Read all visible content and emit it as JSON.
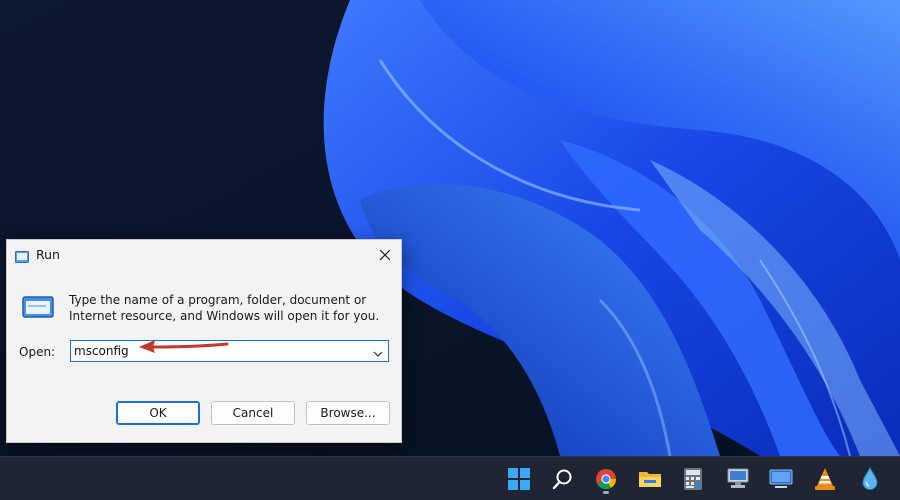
{
  "dialog": {
    "title": "Run",
    "description": "Type the name of a program, folder, document or Internet resource, and Windows will open it for you.",
    "open_label": "Open:",
    "open_value": "msconfig",
    "buttons": {
      "ok": "OK",
      "cancel": "Cancel",
      "browse": "Browse..."
    }
  },
  "taskbar": {
    "icons": [
      {
        "name": "windows-start-icon"
      },
      {
        "name": "search-icon"
      },
      {
        "name": "chrome-icon"
      },
      {
        "name": "file-explorer-icon"
      },
      {
        "name": "calculator-icon"
      },
      {
        "name": "network-computer-icon"
      },
      {
        "name": "remote-desktop-icon"
      },
      {
        "name": "vlc-icon"
      },
      {
        "name": "water-drop-icon"
      }
    ]
  },
  "colors": {
    "accent": "#1f6fd0",
    "wallpaper_base": "#0a1226",
    "wallpaper_blue": "#1a4cf0",
    "taskbar": "#1f2532",
    "annotation_arrow": "#c0392b"
  }
}
